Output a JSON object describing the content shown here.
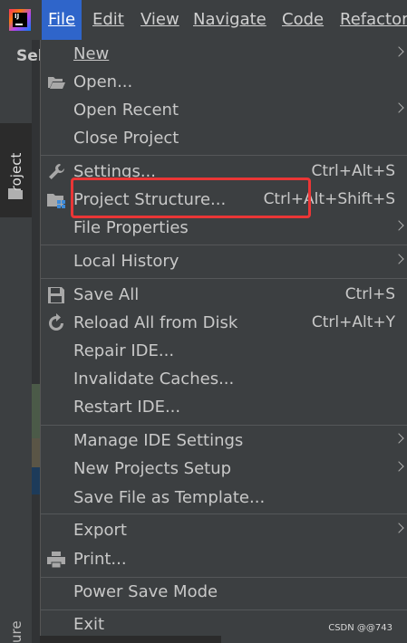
{
  "menubar": {
    "logo_text": "IJ",
    "file": "File",
    "edit": "Edit",
    "view": "View",
    "navigate": "Navigate",
    "code": "Code",
    "refactor": "Refactor"
  },
  "sidebar": {
    "project_tab": "Project",
    "structure_tab": "ure",
    "peek_text": "Sel"
  },
  "file_menu": {
    "new": "New",
    "open": "Open...",
    "open_recent": "Open Recent",
    "close_project": "Close Project",
    "settings": "Settings...",
    "settings_shortcut": "Ctrl+Alt+S",
    "project_structure": "Project Structure...",
    "project_structure_shortcut": "Ctrl+Alt+Shift+S",
    "file_properties": "File Properties",
    "local_history": "Local History",
    "save_all": "Save All",
    "save_all_shortcut": "Ctrl+S",
    "reload_all": "Reload All from Disk",
    "reload_all_shortcut": "Ctrl+Alt+Y",
    "repair_ide": "Repair IDE...",
    "invalidate_caches": "Invalidate Caches...",
    "restart_ide": "Restart IDE...",
    "manage_ide_settings": "Manage IDE Settings",
    "new_projects_setup": "New Projects Setup",
    "save_file_as_template": "Save File as Template...",
    "export": "Export",
    "print": "Print...",
    "power_save_mode": "Power Save Mode",
    "exit": "Exit"
  },
  "watermark": "CSDN @@743",
  "colors": {
    "menu_bg": "#3c3f41",
    "active_menu": "#2f65ca",
    "highlight_box": "#ea3636"
  }
}
